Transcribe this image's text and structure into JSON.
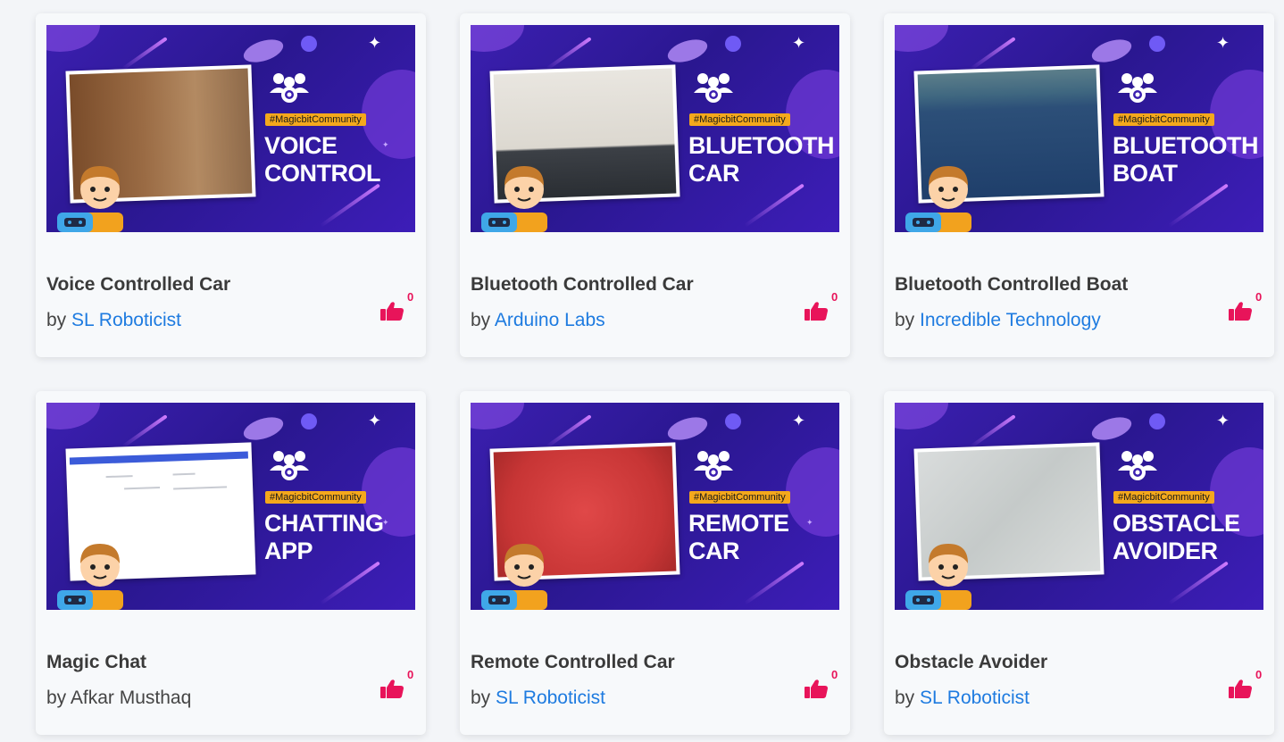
{
  "colors": {
    "accent_pink": "#e8145a",
    "link_blue": "#1e7be0",
    "banner_purple": "#2a1790",
    "tag_orange": "#f4a81c"
  },
  "cards": [
    {
      "banner_tag": "#MagicbitCommunity",
      "banner_title": "VOICE\nCONTROL",
      "title": "Voice Controlled Car",
      "by": "by",
      "author": "SL Roboticist",
      "author_linked": true,
      "likes": "0"
    },
    {
      "banner_tag": "#MagicbitCommunity",
      "banner_title": "BLUETOOTH\nCAR",
      "title": "Bluetooth Controlled Car",
      "by": "by",
      "author": "Arduino Labs",
      "author_linked": true,
      "likes": "0"
    },
    {
      "banner_tag": "#MagicbitCommunity",
      "banner_title": "BLUETOOTH\nBOAT",
      "title": "Bluetooth Controlled Boat",
      "by": "by",
      "author": "Incredible Technology",
      "author_linked": true,
      "likes": "0"
    },
    {
      "banner_tag": "#MagicbitCommunity",
      "banner_title": "CHATTING\nAPP",
      "title": "Magic Chat",
      "by": "by",
      "author": "Afkar Musthaq",
      "author_linked": false,
      "likes": "0"
    },
    {
      "banner_tag": "#MagicbitCommunity",
      "banner_title": "REMOTE\nCAR",
      "title": "Remote Controlled Car",
      "by": "by",
      "author": "SL Roboticist",
      "author_linked": true,
      "likes": "0"
    },
    {
      "banner_tag": "#MagicbitCommunity",
      "banner_title": "OBSTACLE\nAVOIDER",
      "title": "Obstacle Avoider",
      "by": "by",
      "author": "SL Roboticist",
      "author_linked": true,
      "likes": "0"
    }
  ]
}
